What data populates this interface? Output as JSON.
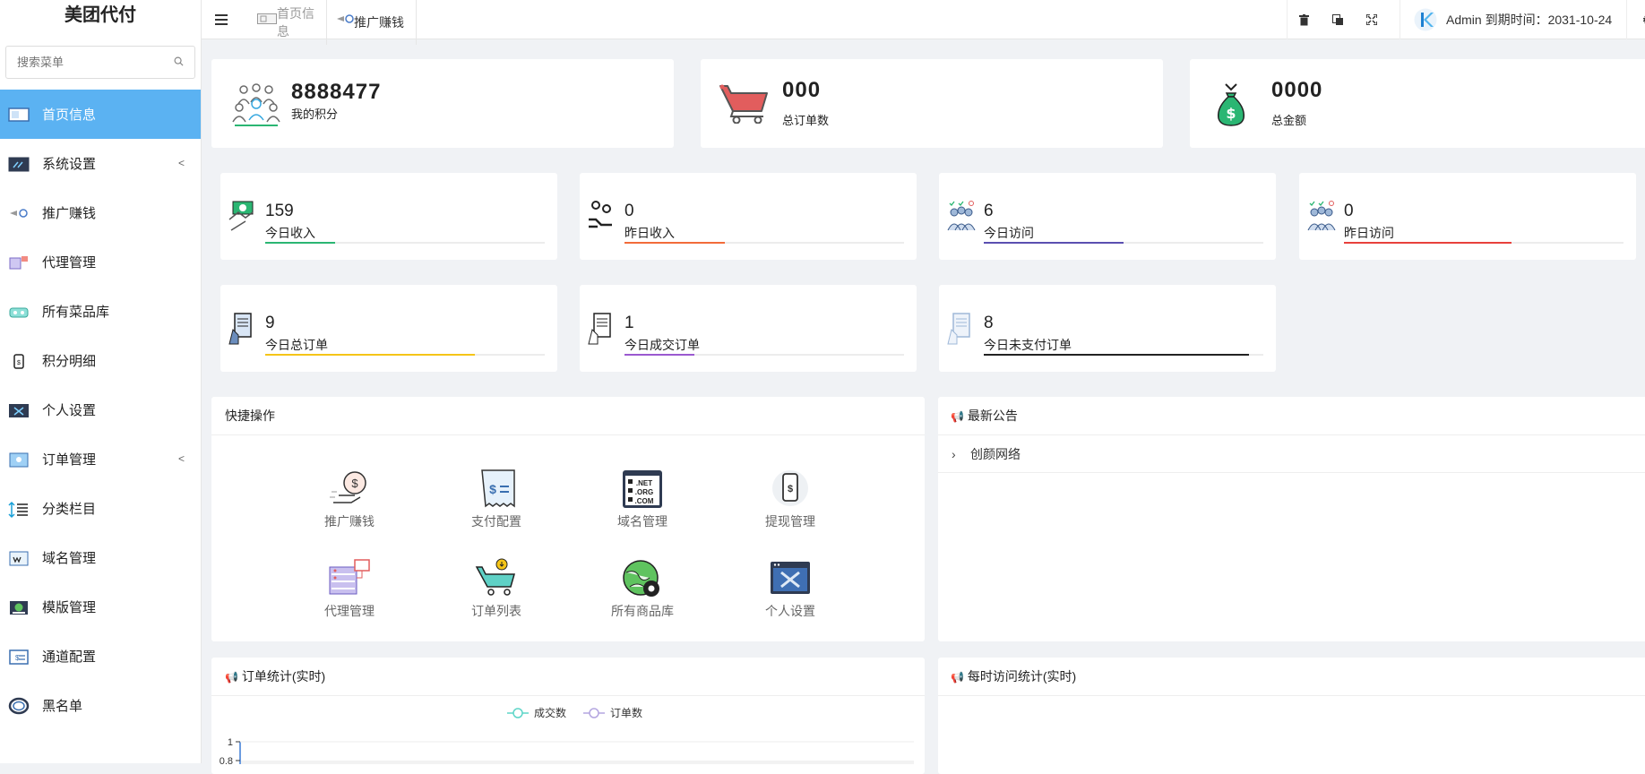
{
  "app": {
    "title": "美团代付"
  },
  "search": {
    "placeholder": "搜索菜单"
  },
  "sidebar": {
    "items": [
      {
        "label": "首页信息",
        "icon": "dashboard-icon"
      },
      {
        "label": "系统设置",
        "icon": "settings-window-icon",
        "expandable": true
      },
      {
        "label": "推广赚钱",
        "icon": "promotion-icon"
      },
      {
        "label": "代理管理",
        "icon": "agent-icon"
      },
      {
        "label": "所有菜品库",
        "icon": "dish-library-icon"
      },
      {
        "label": "积分明细",
        "icon": "points-icon"
      },
      {
        "label": "个人设置",
        "icon": "personal-settings-icon"
      },
      {
        "label": "订单管理",
        "icon": "order-icon",
        "expandable": true
      },
      {
        "label": "分类栏目",
        "icon": "category-list-icon"
      },
      {
        "label": "域名管理",
        "icon": "domain-icon"
      },
      {
        "label": "模版管理",
        "icon": "template-icon"
      },
      {
        "label": "通道配置",
        "icon": "channel-icon"
      },
      {
        "label": "黑名单",
        "icon": "blacklist-icon"
      }
    ]
  },
  "tabs": [
    {
      "label": "首页信息"
    },
    {
      "label": "推广赚钱"
    }
  ],
  "header": {
    "user": "Admin 到期时间：2031-10-24"
  },
  "summary": [
    {
      "value": "8888477",
      "label": "我的积分",
      "icon": "team-icon"
    },
    {
      "value": "000",
      "label": "总订单数",
      "icon": "shopping-cart-icon"
    },
    {
      "value": "0000",
      "label": "总金额",
      "icon": "money-bag-icon"
    }
  ],
  "stats": [
    {
      "value": "159",
      "label": "今日收入",
      "color": "#2bb673",
      "fill": 0.25
    },
    {
      "value": "0",
      "label": "昨日收入",
      "color": "#f26b3a",
      "fill": 0.36
    },
    {
      "value": "6",
      "label": "今日访问",
      "color": "#5a4fb0",
      "fill": 0.5
    },
    {
      "value": "0",
      "label": "昨日访问",
      "color": "#e8403c",
      "fill": 0.6
    },
    {
      "value": "9",
      "label": "今日总订单",
      "color": "#f5c518",
      "fill": 0.75
    },
    {
      "value": "1",
      "label": "今日成交订单",
      "color": "#9b59d0",
      "fill": 0.25
    },
    {
      "value": "8",
      "label": "今日未支付订单",
      "color": "#222222",
      "fill": 0.95
    }
  ],
  "quick": {
    "title": "快捷操作",
    "items": [
      {
        "label": "推广赚钱",
        "icon": "money-hand-icon"
      },
      {
        "label": "支付配置",
        "icon": "receipt-icon"
      },
      {
        "label": "域名管理",
        "icon": "domain-www-icon"
      },
      {
        "label": "提现管理",
        "icon": "phone-dollar-icon"
      },
      {
        "label": "代理管理",
        "icon": "server-icon"
      },
      {
        "label": "订单列表",
        "icon": "cart-download-icon"
      },
      {
        "label": "所有商品库",
        "icon": "globe-gear-icon"
      },
      {
        "label": "个人设置",
        "icon": "tools-window-icon"
      }
    ]
  },
  "notice": {
    "title": "最新公告",
    "items": [
      {
        "label": "创颜网络"
      }
    ]
  },
  "order_chart": {
    "title": "订单统计(实时)"
  },
  "visit_chart": {
    "title": "每时访问统计(实时)"
  },
  "chart_data": {
    "type": "line",
    "series": [
      {
        "name": "成交数",
        "color": "#5ed5c8",
        "values": []
      },
      {
        "name": "订单数",
        "color": "#b4a6e0",
        "values": []
      }
    ],
    "yticks": [
      "1",
      "0.8"
    ]
  }
}
